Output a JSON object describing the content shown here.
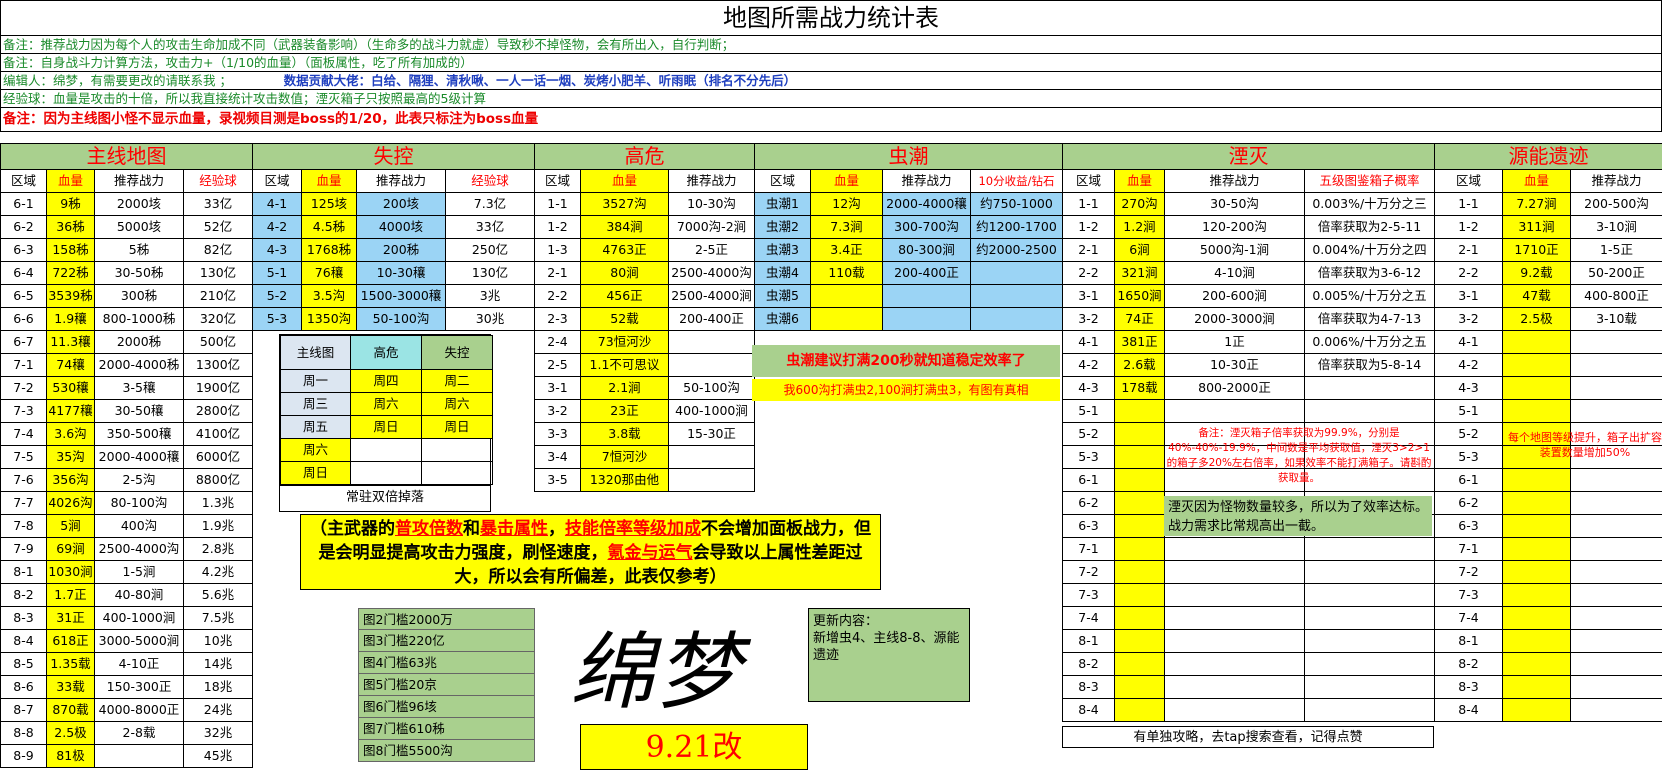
{
  "title": "地图所需战力统计表",
  "notes": {
    "n1": "备注：推荐战力因为每个人的攻击生命加成不同（武器装备影响）（生命多的战斗力就虚）导致秒不掉怪物，会有所出入，自行判断；",
    "n2": "备注：自身战斗力计算方法，攻击力+（1/10的血量）（面板属性，吃了所有加成的）",
    "n3a": "编辑人：绵梦，有需要更改的请联系我 ；",
    "n3b": "数据贡献大佬：白给、隔狸、清秋啾、一人一话一烟、炭烤小肥羊、听雨眠（排名不分先后）",
    "n4": "经验球：血量是攻击的十倍，所以我直接统计攻击数值；湮灭箱子只按照最高的5级计算",
    "n5": "备注：因为主线图小怪不显示血量，录视频目测是boss的1/20，此表只标注为boss血量"
  },
  "sections": {
    "main": "主线地图",
    "shikong": "失控",
    "gaowei": "高危",
    "chongchao": "虫潮",
    "yanmie": "湮灭",
    "yuanneng": "源能遗迹"
  },
  "headers": {
    "area": "区域",
    "hp": "血量",
    "power": "推荐战力",
    "exp": "经验球",
    "gain": "10分收益/钻石",
    "box": "五级图鉴箱子概率"
  },
  "main_rows": [
    [
      "6-1",
      "9秭",
      "2000垓",
      "33亿"
    ],
    [
      "6-2",
      "36秭",
      "5000垓",
      "52亿"
    ],
    [
      "6-3",
      "158秭",
      "5秭",
      "82亿"
    ],
    [
      "6-4",
      "722秭",
      "30-50秭",
      "130亿"
    ],
    [
      "6-5",
      "3539秭",
      "300秭",
      "210亿"
    ],
    [
      "6-6",
      "1.9穰",
      "800-1000秭",
      "320亿"
    ],
    [
      "6-7",
      "11.3穰",
      "2000秭",
      "500亿"
    ],
    [
      "7-1",
      "74穰",
      "2000-4000秭",
      "1300亿"
    ],
    [
      "7-2",
      "530穰",
      "3-5穰",
      "1900亿"
    ],
    [
      "7-3",
      "4177穰",
      "30-50穰",
      "2800亿"
    ],
    [
      "7-4",
      "3.6沟",
      "350-500穰",
      "4100亿"
    ],
    [
      "7-5",
      "35沟",
      "2000-4000穰",
      "6000亿"
    ],
    [
      "7-6",
      "356沟",
      "2-5沟",
      "8800亿"
    ],
    [
      "7-7",
      "4026沟",
      "80-100沟",
      "1.3兆"
    ],
    [
      "7-8",
      "5涧",
      "400沟",
      "1.9兆"
    ],
    [
      "7-9",
      "69涧",
      "2500-4000沟",
      "2.8兆"
    ],
    [
      "8-1",
      "1030涧",
      "1-5涧",
      "4.2兆"
    ],
    [
      "8-2",
      "1.7正",
      "40-80涧",
      "5.6兆"
    ],
    [
      "8-3",
      "31正",
      "400-1000涧",
      "7.5兆"
    ],
    [
      "8-4",
      "618正",
      "3000-5000涧",
      "10兆"
    ],
    [
      "8-5",
      "1.35载",
      "4-10正",
      "14兆"
    ],
    [
      "8-6",
      "33载",
      "150-300正",
      "18兆"
    ],
    [
      "8-7",
      "870载",
      "4000-8000正",
      "24兆"
    ],
    [
      "8-8",
      "2.5极",
      "2-8载",
      "32兆"
    ],
    [
      "8-9",
      "81极",
      "",
      "45兆"
    ]
  ],
  "shikong_rows": [
    [
      "4-1",
      "125垓",
      "200垓",
      "7.3亿"
    ],
    [
      "4-2",
      "4.5秭",
      "4000垓",
      "33亿"
    ],
    [
      "4-3",
      "1768秭",
      "200秭",
      "250亿"
    ],
    [
      "5-1",
      "76穰",
      "10-30穰",
      "130亿"
    ],
    [
      "5-2",
      "3.5沟",
      "1500-3000穰",
      "3兆"
    ],
    [
      "5-3",
      "1350沟",
      "50-100沟",
      "30兆"
    ]
  ],
  "gaowei_rows": [
    [
      "1-1",
      "3527沟",
      "10-30沟"
    ],
    [
      "1-2",
      "384涧",
      "7000沟-2涧"
    ],
    [
      "1-3",
      "4763正",
      "2-5正"
    ],
    [
      "2-1",
      "80涧",
      "2500-4000沟"
    ],
    [
      "2-2",
      "456正",
      "2500-4000涧"
    ],
    [
      "2-3",
      "52载",
      "200-400正"
    ],
    [
      "2-4",
      "73恒河沙",
      ""
    ],
    [
      "2-5",
      "1.1不可思议",
      ""
    ],
    [
      "3-1",
      "2.1涧",
      "50-100沟"
    ],
    [
      "3-2",
      "23正",
      "400-1000涧"
    ],
    [
      "3-3",
      "3.8载",
      "15-30正"
    ],
    [
      "3-4",
      "7恒河沙",
      ""
    ],
    [
      "3-5",
      "1320那由他",
      ""
    ]
  ],
  "chong_rows": [
    [
      "虫潮1",
      "12沟",
      "2000-4000穰",
      "约750-1000"
    ],
    [
      "虫潮2",
      "7.3涧",
      "300-700沟",
      "约1200-1700"
    ],
    [
      "虫潮3",
      "3.4正",
      "80-300涧",
      "约2000-2500"
    ],
    [
      "虫潮4",
      "110载",
      "200-400正",
      ""
    ],
    [
      "虫潮5",
      "",
      "",
      ""
    ],
    [
      "虫潮6",
      "",
      "",
      ""
    ]
  ],
  "yanmie_rows": [
    [
      "1-1",
      "270沟",
      "30-50沟",
      "0.003%/十万分之三"
    ],
    [
      "1-2",
      "1.2涧",
      "120-200沟",
      "倍率获取为2-5-11"
    ],
    [
      "2-1",
      "6涧",
      "5000沟-1涧",
      "0.004%/十万分之四"
    ],
    [
      "2-2",
      "321涧",
      "4-10涧",
      "倍率获取为3-6-12"
    ],
    [
      "3-1",
      "1650涧",
      "200-600涧",
      "0.005%/十万分之五"
    ],
    [
      "3-2",
      "74正",
      "2000-3000涧",
      "倍率获取为4-7-13"
    ],
    [
      "4-1",
      "381正",
      "1正",
      "0.006%/十万分之五"
    ],
    [
      "4-2",
      "2.6载",
      "10-30正",
      "倍率获取为5-8-14"
    ],
    [
      "4-3",
      "178载",
      "800-2000正",
      ""
    ],
    [
      "5-1",
      "",
      "",
      ""
    ],
    [
      "5-2",
      "",
      "",
      ""
    ],
    [
      "5-3",
      "",
      "",
      ""
    ],
    [
      "6-1",
      "",
      "",
      ""
    ],
    [
      "6-2",
      "",
      "",
      ""
    ],
    [
      "6-3",
      "",
      "",
      ""
    ],
    [
      "7-1",
      "",
      "",
      ""
    ],
    [
      "7-2",
      "",
      "",
      ""
    ],
    [
      "7-3",
      "",
      "",
      ""
    ],
    [
      "7-4",
      "",
      "",
      ""
    ],
    [
      "8-1",
      "",
      "",
      ""
    ],
    [
      "8-2",
      "",
      "",
      ""
    ],
    [
      "8-3",
      "",
      "",
      ""
    ],
    [
      "8-4",
      "",
      "",
      ""
    ]
  ],
  "yuan_rows": [
    [
      "1-1",
      "7.27涧",
      "200-500沟"
    ],
    [
      "1-2",
      "311涧",
      "3-10涧"
    ],
    [
      "2-1",
      "1710正",
      "1-5正"
    ],
    [
      "2-2",
      "9.2载",
      "50-200正"
    ],
    [
      "3-1",
      "47载",
      "400-800正"
    ],
    [
      "3-2",
      "2.5极",
      "3-10载"
    ],
    [
      "4-1",
      "",
      ""
    ],
    [
      "4-2",
      "",
      ""
    ],
    [
      "4-3",
      "",
      ""
    ],
    [
      "5-1",
      "",
      ""
    ],
    [
      "5-2",
      "",
      ""
    ],
    [
      "5-3",
      "",
      ""
    ],
    [
      "6-1",
      "",
      ""
    ],
    [
      "6-2",
      "",
      ""
    ],
    [
      "6-3",
      "",
      ""
    ],
    [
      "7-1",
      "",
      ""
    ],
    [
      "7-2",
      "",
      ""
    ],
    [
      "7-3",
      "",
      ""
    ],
    [
      "7-4",
      "",
      ""
    ],
    [
      "8-1",
      "",
      ""
    ],
    [
      "8-2",
      "",
      ""
    ],
    [
      "8-3",
      "",
      ""
    ],
    [
      "8-4",
      "",
      ""
    ]
  ],
  "week": {
    "head": [
      "主线图",
      "高危",
      "失控"
    ],
    "rows": [
      [
        "周一",
        "周四",
        "周二"
      ],
      [
        "周三",
        "周六",
        "周六"
      ],
      [
        "周五",
        "周日",
        "周日"
      ],
      [
        "周六",
        "",
        ""
      ],
      [
        "周日",
        "",
        ""
      ]
    ],
    "foot": "常驻双倍掉落"
  },
  "yellow": {
    "t1": "（主武器的",
    "r1": "普攻倍数",
    "t2": "和",
    "r2": "暴击属性",
    "t3": "，",
    "r3": "技能倍率等级加成",
    "t4": "不会增加面板战力，但是会明显提高攻击力强度，刷怪速度，",
    "r4": "氪金与运气",
    "t5": "会导致以上属性差距过大，所以会有所偏差，此表仅参考）"
  },
  "gates": [
    "图2门槛2000万",
    "图3门槛220亿",
    "图4门槛63兆",
    "图5门槛20京",
    "图6门槛96垓",
    "图7门槛610秭",
    "图8门槛5500沟"
  ],
  "signature": "绵梦",
  "version": "9.21改",
  "update": "更新内容：\n新增虫4、主线8-8、源能遗迹",
  "chong_note1": "虫潮建议打满200秒就知道稳定效率了",
  "chong_note2": "我600沟打满虫2,100涧打满虫3，有图有真相",
  "yanmie_note1": "备注：湮灭箱子倍率获取为99.9%，分别是40%-40%-19.9%，中间数是平均获取值，湮灭3>2>1的箱子多20%左右倍率，如果效率不能打满箱子。请斟酌获取量。",
  "yanmie_note2": "湮灭因为怪物数量较多，所以为了效率达标。战力需求比常规高出一截。",
  "yuan_note": "每个地图等级提升，箱子出扩容装置数量增加50%",
  "footer": "有单独攻略，去tap搜索查看，记得点赞",
  "colors": {
    "green": "#a9d08e",
    "yellow": "#ffff00",
    "cyan": "#9bd4f5",
    "red": "#ff0000"
  }
}
